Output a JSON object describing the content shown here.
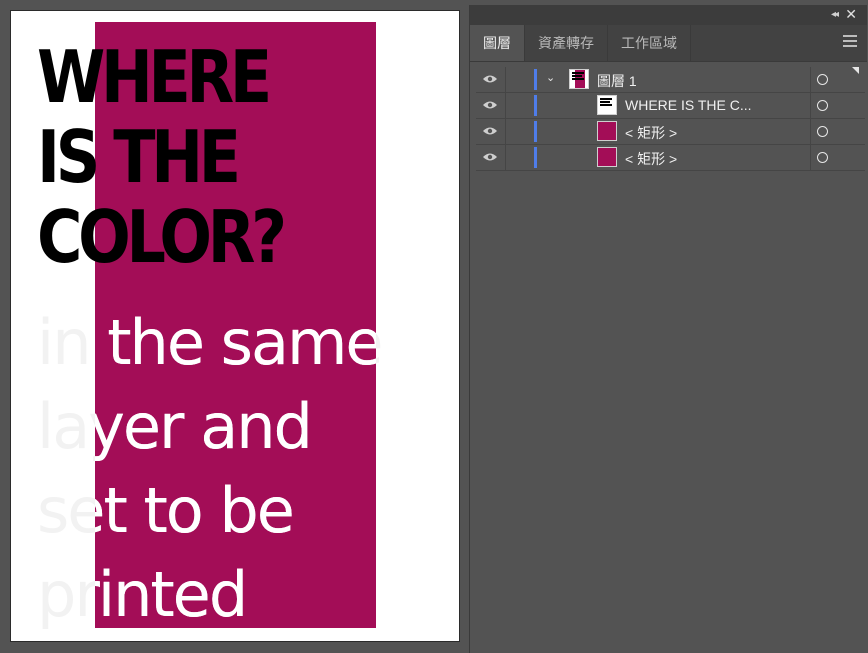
{
  "artboard": {
    "headline_lines": [
      "WHERE",
      "IS THE",
      "COLOR?"
    ],
    "body_lines": [
      "in the same",
      "layer and",
      "set to be",
      "printed"
    ],
    "rect_color": "#a30d57"
  },
  "panel": {
    "tabs": [
      {
        "label": "圖層",
        "active": true
      },
      {
        "label": "資產轉存",
        "active": false
      },
      {
        "label": "工作區域",
        "active": false
      }
    ],
    "layers": [
      {
        "name": "圖層 1",
        "type": "layer",
        "expanded": true
      },
      {
        "name": "WHERE  IS THE  C...",
        "type": "text"
      },
      {
        "name": "< 矩形 >",
        "type": "rectangle"
      },
      {
        "name": "< 矩形 >",
        "type": "rectangle"
      }
    ],
    "icons": {
      "collapse": "double-chevron-left-icon",
      "close": "close-icon",
      "menu": "hamburger-menu-icon",
      "visibility": "eye-icon",
      "target": "target-circle-icon"
    },
    "layer_color": "#4f7de9"
  }
}
